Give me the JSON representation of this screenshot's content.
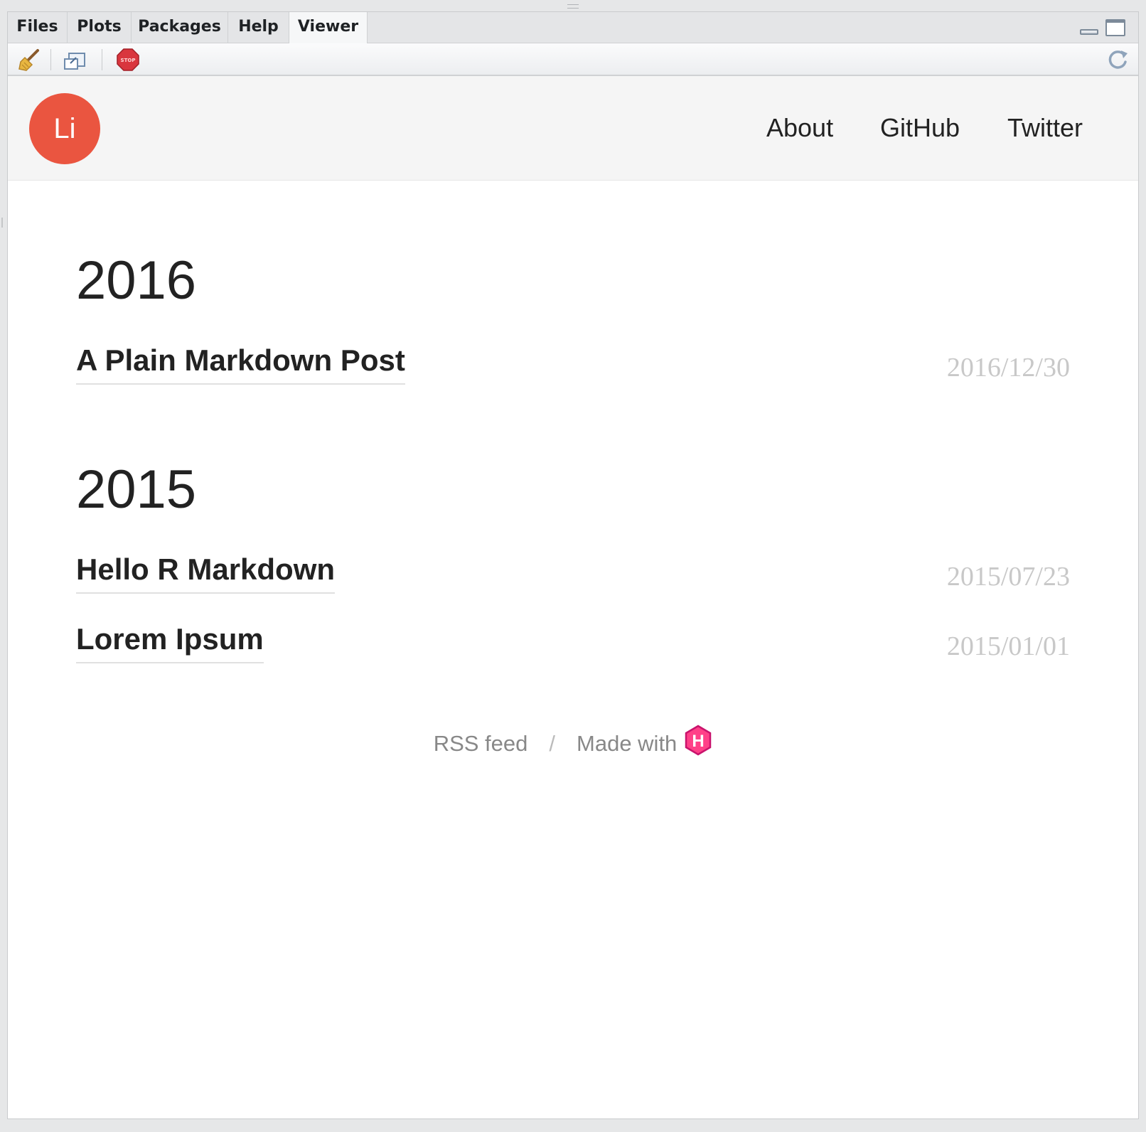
{
  "tabs": [
    {
      "label": "Files",
      "active": false
    },
    {
      "label": "Plots",
      "active": false
    },
    {
      "label": "Packages",
      "active": false
    },
    {
      "label": "Help",
      "active": false
    },
    {
      "label": "Viewer",
      "active": true
    }
  ],
  "toolbar": {
    "buttons": [
      "broom-icon",
      "viewer-popout-icon",
      "stop-icon"
    ],
    "stop_text": "STOP",
    "refresh": "refresh-icon"
  },
  "site": {
    "logo_text": "Li",
    "logo_color": "#ea5540",
    "nav": [
      "About",
      "GitHub",
      "Twitter"
    ]
  },
  "archive": [
    {
      "year": "2016",
      "posts": [
        {
          "title": "A Plain Markdown Post",
          "date": "2016/12/30"
        }
      ]
    },
    {
      "year": "2015",
      "posts": [
        {
          "title": "Hello R Markdown",
          "date": "2015/07/23"
        },
        {
          "title": "Lorem Ipsum",
          "date": "2015/01/01"
        }
      ]
    }
  ],
  "footer": {
    "rss": "RSS feed",
    "separator": "/",
    "made_with": "Made with",
    "hugo_letter": "H",
    "hugo_color": "#ff4088"
  }
}
